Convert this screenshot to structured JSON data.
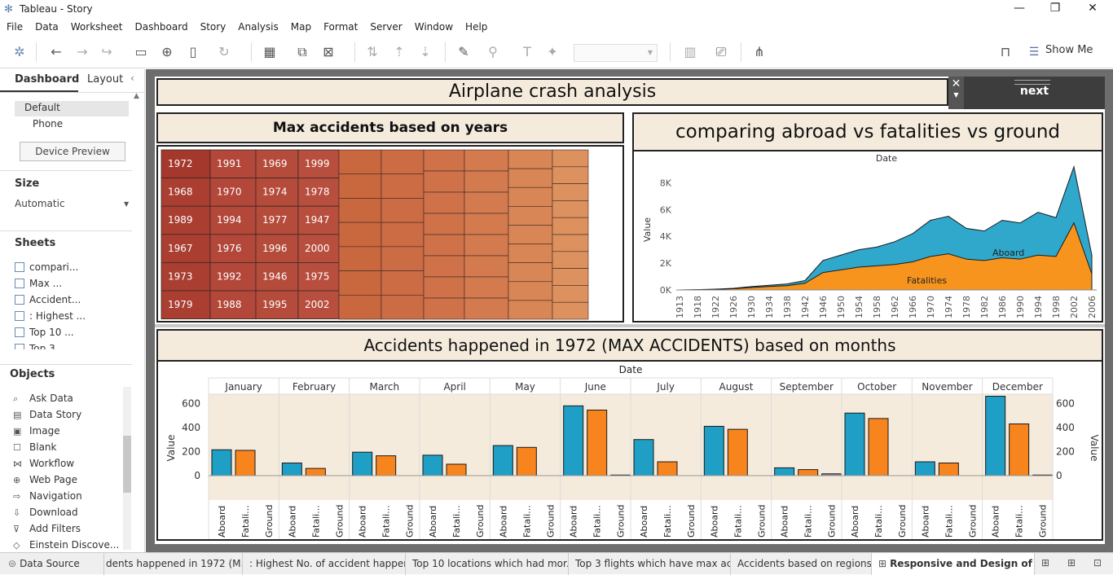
{
  "window": {
    "title": "Tableau - Story",
    "controls": {
      "minimize": "—",
      "restore": "❐",
      "close": "✕"
    }
  },
  "menu": [
    "File",
    "Data",
    "Worksheet",
    "Dashboard",
    "Story",
    "Analysis",
    "Map",
    "Format",
    "Server",
    "Window",
    "Help"
  ],
  "toolbar": {
    "show_me": "Show Me"
  },
  "left": {
    "tabs": [
      "Dashboard",
      "Layout"
    ],
    "device": {
      "options": [
        "Default",
        "Phone"
      ],
      "preview_button": "Device Preview"
    },
    "size": {
      "label": "Size",
      "value": "Automatic"
    },
    "sheets": {
      "label": "Sheets",
      "items": [
        "compari...",
        "Max ...",
        "Accident...",
        ": Highest ...",
        "Top 10 ...",
        "Top 3"
      ]
    },
    "objects": {
      "label": "Objects",
      "items": [
        "Ask Data",
        "Data Story",
        "Image",
        "Blank",
        "Workflow",
        "Web Page",
        "Navigation",
        "Download",
        "Add Filters",
        "Einstein Discove..."
      ]
    }
  },
  "dashboard": {
    "title": "Airplane crash analysis",
    "next_label": "next",
    "treemap": {
      "title": "Max accidents based on years",
      "years": [
        "1972",
        "1968",
        "1989",
        "1967",
        "1973",
        "1979",
        "1991",
        "1970",
        "1994",
        "1976",
        "1992",
        "1988",
        "1969",
        "1974",
        "1977",
        "1996",
        "1946",
        "1995",
        "1999",
        "1978",
        "1947",
        "2000",
        "1975",
        "2002"
      ]
    },
    "area": {
      "title": "comparing abroad vs fatalities vs ground",
      "top_label": "Date",
      "y_label": "Value",
      "series": [
        "Aboard",
        "Fatalities"
      ]
    },
    "bars": {
      "title": "Accidents happened in 1972 (MAX ACCIDENTS) based on months",
      "top_label": "Date",
      "y_label": "Value",
      "measures": [
        "Aboard",
        "Fatali...",
        "Ground"
      ]
    }
  },
  "chart_data": [
    {
      "type": "treemap",
      "title": "Max accidents based on years",
      "labels": [
        "1972",
        "1968",
        "1989",
        "1967",
        "1973",
        "1979",
        "1991",
        "1970",
        "1994",
        "1976",
        "1992",
        "1988",
        "1969",
        "1974",
        "1977",
        "1996",
        "1946",
        "1995",
        "1999",
        "1978",
        "1947",
        "2000",
        "1975",
        "2002"
      ]
    },
    {
      "type": "area",
      "title": "comparing abroad vs fatalities vs ground",
      "xlabel": "Date",
      "ylabel": "Value",
      "x": [
        "1913",
        "1918",
        "1922",
        "1926",
        "1930",
        "1934",
        "1938",
        "1942",
        "1946",
        "1950",
        "1954",
        "1958",
        "1962",
        "1966",
        "1970",
        "1974",
        "1978",
        "1982",
        "1986",
        "1990",
        "1994",
        "1998",
        "2002",
        "2006"
      ],
      "yticks": [
        "0K",
        "2K",
        "4K",
        "6K",
        "8K"
      ],
      "ylim": [
        0,
        9000
      ],
      "series": [
        {
          "name": "Aboard",
          "values": [
            0,
            20,
            60,
            120,
            250,
            350,
            450,
            700,
            2200,
            2600,
            3000,
            3200,
            3600,
            4200,
            5200,
            5500,
            4600,
            4400,
            5200,
            5000,
            5800,
            5400,
            9200,
            2600
          ]
        },
        {
          "name": "Fatalities",
          "values": [
            0,
            15,
            40,
            90,
            180,
            260,
            320,
            500,
            1300,
            1500,
            1700,
            1800,
            1900,
            2100,
            2500,
            2700,
            2300,
            2200,
            2400,
            2300,
            2600,
            2500,
            5000,
            1200
          ]
        }
      ]
    },
    {
      "type": "bar",
      "title": "Accidents happened in 1972 (MAX ACCIDENTS) based on months",
      "xlabel": "Date",
      "ylabel": "Value",
      "ylim": [
        0,
        650
      ],
      "yticks": [
        "0",
        "200",
        "400",
        "600"
      ],
      "categories": [
        "January",
        "February",
        "March",
        "April",
        "May",
        "June",
        "July",
        "August",
        "September",
        "October",
        "November",
        "December"
      ],
      "series": [
        {
          "name": "Aboard",
          "values": [
            215,
            105,
            195,
            170,
            250,
            580,
            300,
            410,
            65,
            520,
            115,
            660
          ]
        },
        {
          "name": "Fatali...",
          "values": [
            210,
            60,
            165,
            95,
            235,
            545,
            115,
            385,
            50,
            475,
            105,
            430
          ]
        },
        {
          "name": "Ground",
          "values": [
            0,
            0,
            0,
            0,
            0,
            5,
            0,
            0,
            15,
            0,
            0,
            5
          ]
        }
      ]
    }
  ],
  "tabs": [
    "Data Source",
    "dents happened in 1972 (M...",
    ": Highest No. of accident happen...",
    "Top 10 locations which had mor...",
    "Top 3 flights which have max ac...",
    "Accidents based on regions",
    "Responsive and Design of D..."
  ]
}
